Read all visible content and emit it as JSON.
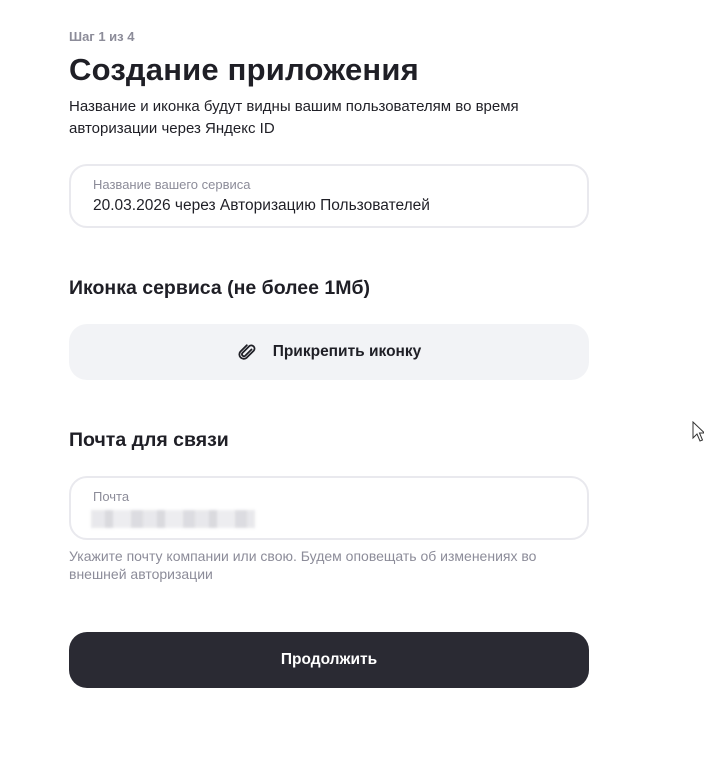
{
  "step": "Шаг 1 из 4",
  "title": "Создание приложения",
  "subtitle": "Название и иконка будут видны вашим пользователям во время авторизации через Яндекс ID",
  "service_name_field": {
    "label": "Название вашего сервиса",
    "value": "20.03.2026 через Авторизацию Пользователей"
  },
  "icon_section": {
    "heading": "Иконка сервиса (не более 1Мб)",
    "attach_button_label": "Прикрепить иконку",
    "icon": "paperclip-icon"
  },
  "email_section": {
    "heading": "Почта для связи",
    "field_label": "Почта",
    "value_state": "blurred",
    "hint": "Укажите почту компании или свою. Будем оповещать об изменениях во внешней авторизации"
  },
  "continue_button_label": "Продолжить",
  "colors": {
    "primary_button": "#2a2a33",
    "secondary_button": "#f2f3f6",
    "muted_text": "#8c8c99",
    "field_border": "#e9e9ee"
  }
}
